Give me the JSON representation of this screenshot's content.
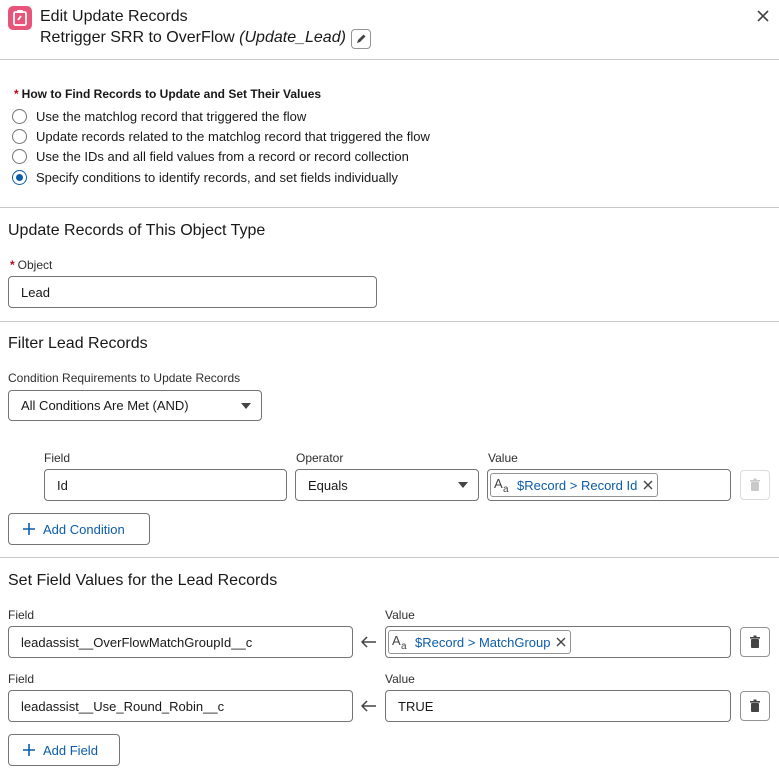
{
  "header": {
    "title": "Edit Update Records",
    "subtitle_name": "Retrigger SRR to OverFlow",
    "subtitle_api": "(Update_Lead)"
  },
  "find_records": {
    "required_mark": "*",
    "label": "How to Find Records to Update and Set Their Values",
    "options": [
      {
        "label": "Use the matchlog record that triggered the flow",
        "checked": false
      },
      {
        "label": "Update records related to the matchlog record that triggered the flow",
        "checked": false
      },
      {
        "label": "Use the IDs and all field values from a record or record collection",
        "checked": false
      },
      {
        "label": "Specify conditions to identify records, and set fields individually",
        "checked": true
      }
    ]
  },
  "object_section": {
    "heading": "Update Records of This Object Type",
    "object_label": "Object",
    "object_value": "Lead"
  },
  "filter_section": {
    "heading": "Filter Lead Records",
    "requirement_label": "Condition Requirements to Update Records",
    "requirement_value": "All Conditions Are Met (AND)",
    "field_label": "Field",
    "operator_label": "Operator",
    "value_label": "Value",
    "condition": {
      "field": "Id",
      "operator": "Equals",
      "value": "$Record > Record Id"
    },
    "add_condition_label": "Add Condition"
  },
  "set_fields_section": {
    "heading": "Set Field Values for the Lead Records",
    "rows": [
      {
        "field_label": "Field",
        "value_label": "Value",
        "field": "leadassist__OverFlowMatchGroupId__c",
        "value": "$Record > MatchGroup"
      },
      {
        "field_label": "Field",
        "value_label": "Value",
        "field": "leadassist__Use_Round_Robin__c",
        "value": "TRUE"
      }
    ],
    "add_field_label": "Add Field"
  },
  "colors": {
    "accent": "#0b5cab",
    "required": "#ba0517",
    "app_icon": "#e8557a"
  }
}
